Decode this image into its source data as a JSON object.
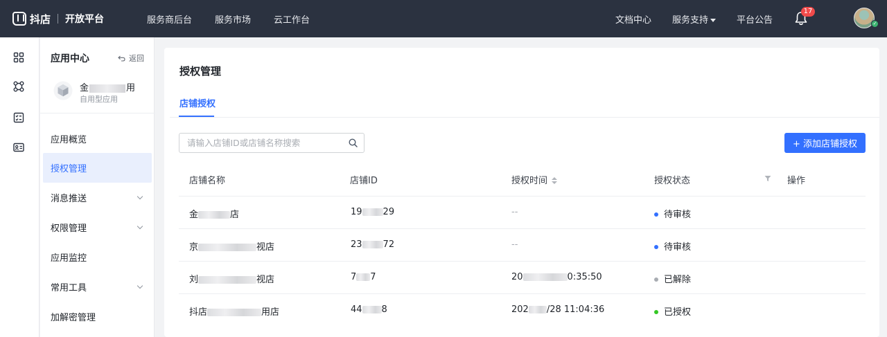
{
  "header": {
    "brand_name": "抖店",
    "brand_sub": "开放平台",
    "nav_left": [
      "服务商后台",
      "服务市场",
      "云工作台"
    ],
    "nav_right": {
      "docs": "文档中心",
      "support": "服务支持",
      "announcements": "平台公告"
    },
    "notification_count": "17"
  },
  "rail": {
    "icons": [
      "grid-icon",
      "nodes-icon",
      "checklist-icon",
      "id-card-icon"
    ]
  },
  "sidebar": {
    "title": "应用中心",
    "back_label": "返回",
    "app_name_start": "金",
    "app_name_end": "用",
    "app_type": "自用型应用",
    "items": [
      {
        "label": "应用概览",
        "has_children": false,
        "active": false
      },
      {
        "label": "授权管理",
        "has_children": false,
        "active": true
      },
      {
        "label": "消息推送",
        "has_children": true,
        "active": false
      },
      {
        "label": "权限管理",
        "has_children": true,
        "active": false
      },
      {
        "label": "应用监控",
        "has_children": false,
        "active": false
      },
      {
        "label": "常用工具",
        "has_children": true,
        "active": false
      },
      {
        "label": "加解密管理",
        "has_children": false,
        "active": false
      }
    ]
  },
  "main": {
    "title": "授权管理",
    "tab_label": "店铺授权",
    "search_placeholder": "请输入店铺ID或店铺名称搜索",
    "add_button": "+ 添加店铺授权",
    "columns": {
      "name": "店铺名称",
      "id": "店铺ID",
      "time": "授权时间",
      "status": "授权状态",
      "action": "操作"
    },
    "rows": [
      {
        "name_a": "金",
        "name_b": "店",
        "id_a": "19",
        "id_b": "29",
        "time_a": "--",
        "time_b": "",
        "status": "待审核",
        "status_color": "#3370ff"
      },
      {
        "name_a": "京",
        "name_b": "视店",
        "id_a": "23",
        "id_b": "72",
        "time_a": "--",
        "time_b": "",
        "status": "待审核",
        "status_color": "#3370ff"
      },
      {
        "name_a": "刘",
        "name_b": "视店",
        "id_a": "7",
        "id_b": "7",
        "time_a": "20",
        "time_b": "0:35:50",
        "status": "已解除",
        "status_color": "#a8acb2"
      },
      {
        "name_a": "抖店",
        "name_b": "用店",
        "id_a": "44",
        "id_b": "8",
        "time_a": "202",
        "time_b": "/28 11:04:36",
        "status": "已授权",
        "status_color": "#34c724"
      }
    ]
  },
  "colors": {
    "topbar": "#2b3240",
    "accent": "#3370ff",
    "badge": "#f04a4a"
  }
}
